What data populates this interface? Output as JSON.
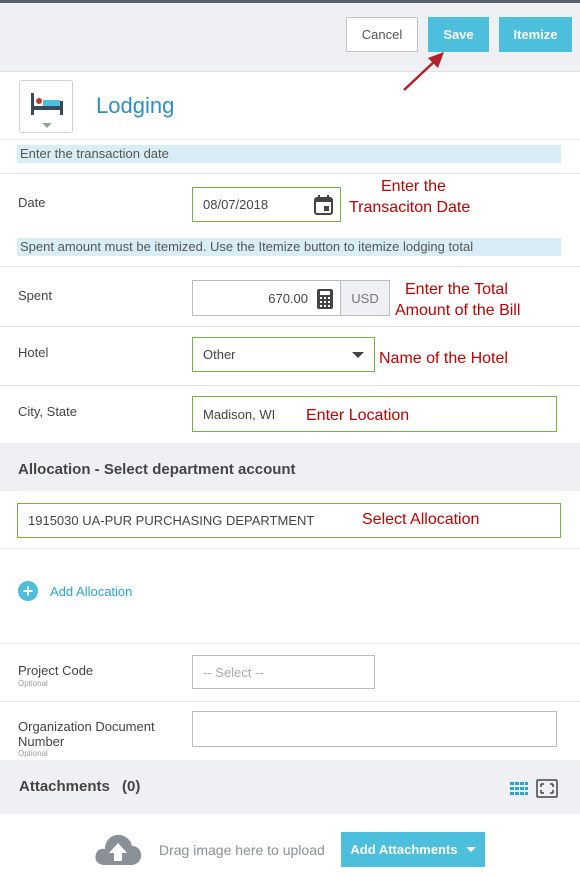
{
  "toolbar": {
    "cancel": "Cancel",
    "save": "Save",
    "itemize": "Itemize"
  },
  "expense": {
    "type_icon": "bed-icon",
    "title": "Lodging"
  },
  "info": {
    "date_hint": "Enter the transaction date",
    "spent_hint": "Spent amount must be itemized. Use the Itemize button to itemize lodging total"
  },
  "fields": {
    "date": {
      "label": "Date",
      "value": "08/07/2018"
    },
    "spent": {
      "label": "Spent",
      "value": "670.00",
      "currency": "USD"
    },
    "hotel": {
      "label": "Hotel",
      "value": "Other"
    },
    "city": {
      "label": "City, State",
      "value": "Madison, WI"
    },
    "project_code": {
      "label": "Project Code",
      "optional": "Optional",
      "placeholder": "-- Select --"
    },
    "org_doc": {
      "label": "Organization Document Number",
      "optional": "Optional",
      "value": ""
    }
  },
  "allocation": {
    "title": "Allocation - Select department account",
    "value": "1915030 UA-PUR PURCHASING DEPARTMENT",
    "add_label": "Add Allocation"
  },
  "attachments": {
    "title": "Attachments",
    "count": "(0)",
    "drag_hint": "Drag image here to upload",
    "add_label": "Add Attachments"
  },
  "annotations": {
    "date": [
      "Enter the",
      "Transaciton Date"
    ],
    "spent": [
      "Enter the Total",
      "Amount of the Bill"
    ],
    "hotel": "Name of the Hotel",
    "city": "Enter Location",
    "allocation": "Select Allocation"
  },
  "colors": {
    "accent": "#4bbfdb",
    "title": "#2b8fc3",
    "annotation": "#c00000",
    "valid_border": "#7cae4a"
  }
}
